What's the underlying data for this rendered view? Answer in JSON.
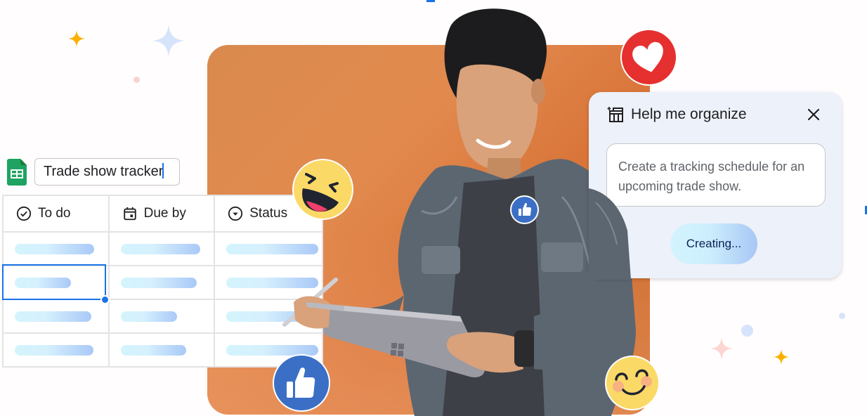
{
  "sheet": {
    "app_icon": "google-sheets-icon",
    "title_value": "Trade show tracker",
    "columns": [
      {
        "label": "To do",
        "icon": "check-circle-icon"
      },
      {
        "label": "Due by",
        "icon": "calendar-icon"
      },
      {
        "label": "Status",
        "icon": "dropdown-circle-icon"
      }
    ],
    "rows": 4,
    "selected_cell": {
      "row": 2,
      "column": 1
    }
  },
  "help_panel": {
    "icon": "table-sparkle-icon",
    "title": "Help me organize",
    "close_icon": "close-icon",
    "prompt": "Create a tracking schedule for an upcoming trade show.",
    "button_label": "Creating..."
  },
  "reactions": [
    {
      "name": "laughing-emoji",
      "color": "#fbd967"
    },
    {
      "name": "thumbs-up-large",
      "color": "#3b6fc6"
    },
    {
      "name": "thumbs-up-badge",
      "color": "#3b6fc6"
    },
    {
      "name": "heart-reaction",
      "color": "#e53935"
    },
    {
      "name": "smiling-emoji",
      "color": "#fbd967"
    }
  ],
  "colors": {
    "accent_blue": "#1a73e8",
    "panel_orange": "#e0874e",
    "sparkle_yellow": "#fbb100",
    "sparkle_blue": "#d6e4fb",
    "sparkle_pink": "#fbd6d2"
  }
}
